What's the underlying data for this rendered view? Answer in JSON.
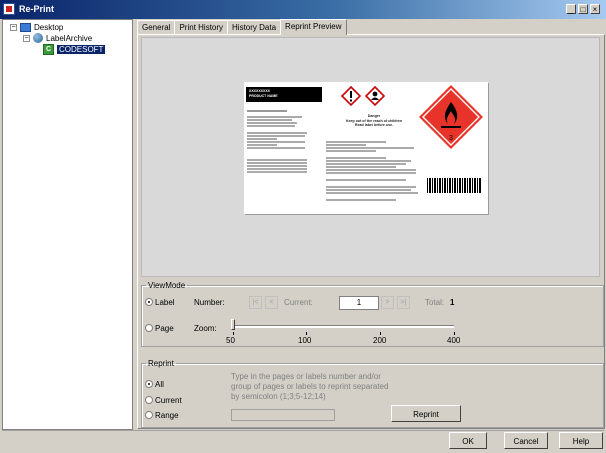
{
  "window": {
    "title": "Re-Print",
    "controls": {
      "minimize": "_",
      "maximize": "□",
      "close": "×"
    }
  },
  "tree": {
    "items": [
      {
        "expander": "−",
        "icon": "desktop-icon",
        "label": "Desktop"
      },
      {
        "expander": "−",
        "icon": "label-archive-icon",
        "label": "LabelArchive"
      },
      {
        "icon": "codesoft-icon",
        "label": "CODESOFT",
        "selected": true
      }
    ]
  },
  "tabs": [
    "General",
    "Print History",
    "History Data",
    "Reprint Preview"
  ],
  "active_tab": "Reprint Preview",
  "preview_label": {
    "product_code": "XXXXXXXXX",
    "product_name": "PRODUCT NAME",
    "signal_word": "Danger",
    "statement1": "Keep out of the reach of children",
    "statement2": "Read label before use."
  },
  "viewmode": {
    "legend": "ViewMode",
    "label_option": "Label",
    "page_option": "Page",
    "number_label": "Number:",
    "current_label": "Current:",
    "current_value": "1",
    "total_label": "Total:",
    "total_value": "1",
    "zoom_label": "Zoom:",
    "zoom_ticks": [
      "50",
      "100",
      "200",
      "400"
    ],
    "nav": {
      "first": "|<",
      "prev": "<",
      "next": ">",
      "last": ">|"
    },
    "selected": "Label"
  },
  "reprint": {
    "legend": "Reprint",
    "options": [
      "All",
      "Current",
      "Range"
    ],
    "selected": "All",
    "help_text": "Type in the pages or labels number and/or group of pages or labels to reprint separated by semicolon (1;3;5-12;14)",
    "button": "Reprint"
  },
  "footer": {
    "ok": "OK",
    "cancel": "Cancel",
    "help": "Help"
  }
}
